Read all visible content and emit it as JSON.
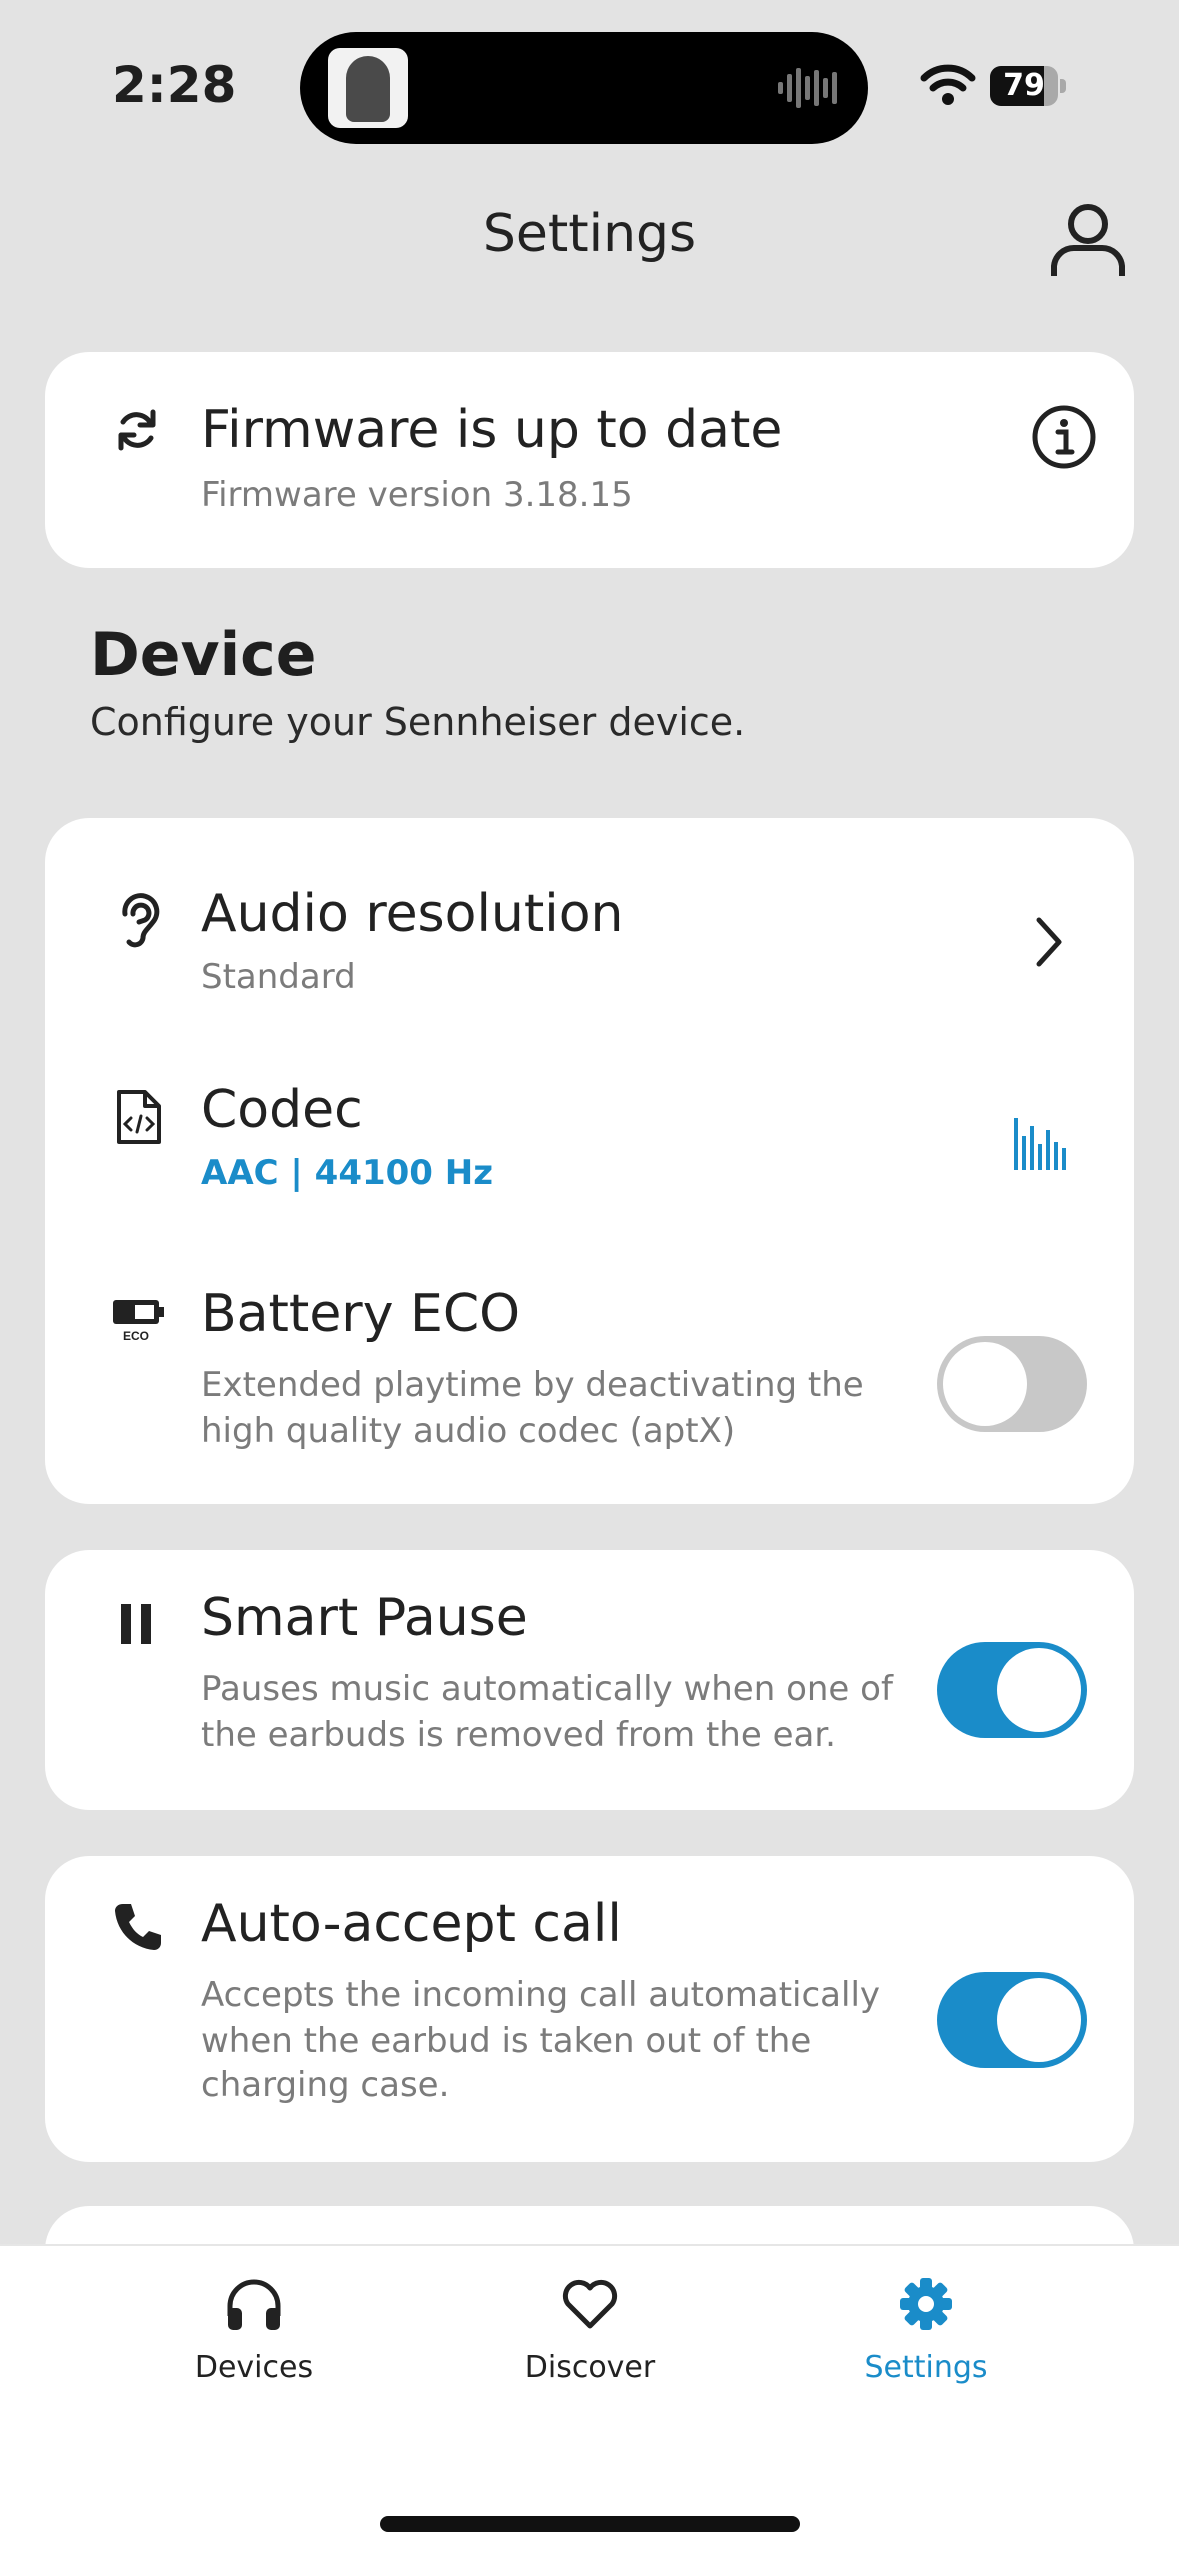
{
  "status_bar": {
    "time": "2:28",
    "battery": "79",
    "battery_level": 0.79
  },
  "header": {
    "title": "Settings",
    "profile_icon": "person-icon"
  },
  "firmware": {
    "title": "Firmware is up to date",
    "version": "Firmware version 3.18.15"
  },
  "device_section": {
    "title": "Device",
    "subtitle": "Configure your Sennheiser device."
  },
  "device_items": {
    "audio_resolution": {
      "title": "Audio resolution",
      "value": "Standard"
    },
    "codec": {
      "title": "Codec",
      "value": "AAC | 44100 Hz"
    },
    "battery_eco": {
      "title": "Battery ECO",
      "description_line1": "Extended playtime by deactivating the",
      "description_line2": "high quality audio codec (aptX)",
      "enabled": false,
      "icon_label": "ECO"
    }
  },
  "smart_pause": {
    "title": "Smart Pause",
    "description_line1": "Pauses music automatically when one of",
    "description_line2": "the earbuds is removed from the ear.",
    "enabled": true
  },
  "auto_accept": {
    "title": "Auto-accept call",
    "description_line1": "Accepts the incoming call automatically",
    "description_line2": "when the earbud is taken out of the",
    "description_line3": "charging case.",
    "enabled": true
  },
  "tabbar": {
    "devices": "Devices",
    "discover": "Discover",
    "settings": "Settings",
    "active": "settings"
  },
  "colors": {
    "accent": "#1a8cc9",
    "background": "#e3e3e3",
    "card": "#ffffff",
    "toggle_off": "#c8c8c8"
  }
}
